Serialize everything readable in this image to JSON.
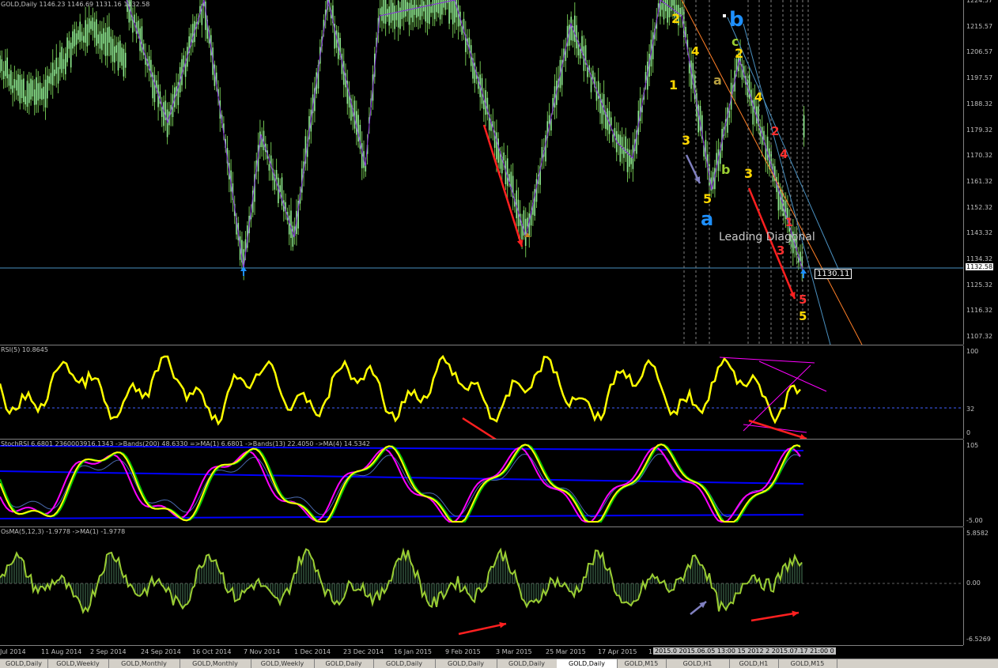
{
  "main_pane": {
    "header": "GOLD,Daily  1146.23 1146.69 1131.16 1132.58",
    "price_ticks": [
      "1224.57",
      "1215.57",
      "1206.57",
      "1197.57",
      "1188.32",
      "1179.32",
      "1170.32",
      "1161.32",
      "1152.32",
      "1143.32",
      "1134.32",
      "1125.32",
      "1116.32",
      "1107.32"
    ],
    "current_price": "1132.58",
    "price_box": "1130.11",
    "annotation": "Leading Diagonal",
    "wave_labels": {
      "w2": "2",
      "w4": "4",
      "w1": "1",
      "w3": "3",
      "w5": "5",
      "big_a": "a",
      "big_b": "b",
      "small_c": "c",
      "small_a": "a",
      "small_b": "b",
      "r2": "2",
      "r4": "4",
      "w4b": "4",
      "w2b": "2",
      "w3b": "3",
      "r1": "1",
      "r3": "3",
      "r5": "5",
      "y5": "5"
    },
    "colors": {
      "candle": "#90ee90",
      "zigzag": "#8a2be2",
      "wave_yellow": "#ffd700",
      "wave_blue": "#1e90ff",
      "arrow_red": "#ff2020",
      "arrow_gray": "#8080c0"
    }
  },
  "rsi_pane": {
    "label": "RSI(5) 10.8645",
    "ticks": [
      "100",
      "32",
      "0"
    ]
  },
  "stoch_pane": {
    "label": "StochRSI 6.6801 2360003916.1343  ->Bands(200) 48.6330  =>MA(1) 6.6801  ->Bands(13) 22.4050  ->MA(4) 14.5342",
    "ticks": [
      "105",
      "-5.00"
    ]
  },
  "osma_pane": {
    "label": "OsMA(5,12,3) -1.9778  ->MA(1) -1.9778",
    "ticks": [
      "5.8582",
      "0.00",
      "-6.5269"
    ]
  },
  "time_axis": {
    "labels": [
      "Jul 2014",
      "11 Aug 2014",
      "2 Sep 2014",
      "24 Sep 2014",
      "16 Oct 2014",
      "7 Nov 2014",
      "1 Dec 2014",
      "23 Dec 2014",
      "16 Jan 2015",
      "9 Feb 2015",
      "3 Mar 2015",
      "25 Mar 2015",
      "17 Apr 2015",
      "1"
    ],
    "highlight": "2015.0  2015.06.05 13:00  15 2012 2 2015.07.17 21:00 0"
  },
  "tabs": [
    "GOLD,Daily",
    "GOLD,Weekly",
    "GOLD,Monthly",
    "GOLD,Monthly",
    "GOLD,Weekly",
    "GOLD,Daily",
    "GOLD,Daily",
    "GOLD,Daily",
    "GOLD,Daily",
    "GOLD,Daily",
    "GOLD,M15",
    "GOLD,H1",
    "GOLD,H1",
    "GOLD,M15"
  ],
  "active_tab_index": 9
}
